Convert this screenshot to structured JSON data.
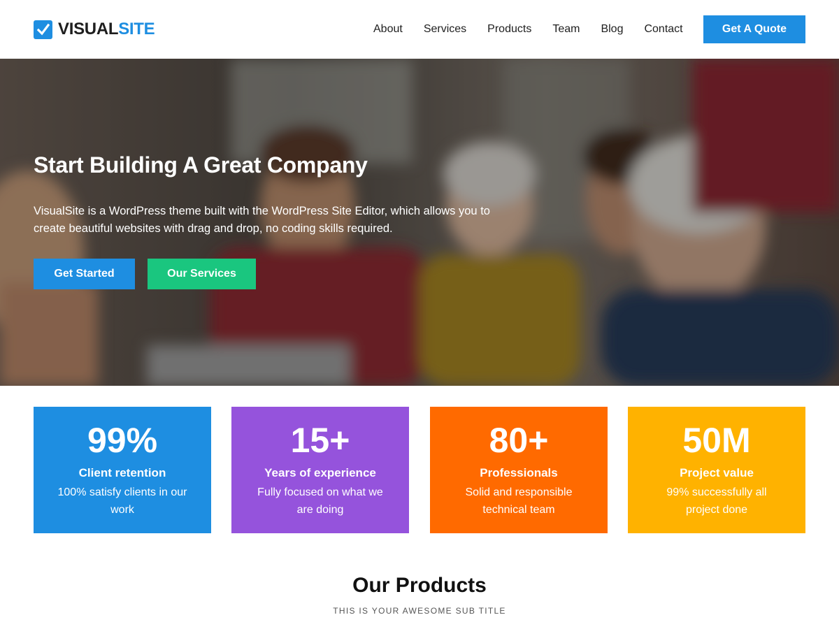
{
  "header": {
    "logo": {
      "part1": "VISUAL",
      "part2": "SITE"
    },
    "nav": [
      "About",
      "Services",
      "Products",
      "Team",
      "Blog",
      "Contact"
    ],
    "cta_label": "Get A Quote"
  },
  "hero": {
    "title": "Start Building A Great Company",
    "text": "VisualSite is a WordPress theme built with the WordPress Site Editor, which allows you to create beautiful websites with drag and drop, no coding skills required.",
    "primary_button": "Get Started",
    "secondary_button": "Our Services"
  },
  "stats": [
    {
      "value": "99%",
      "title": "Client retention",
      "desc": "100% satisfy clients in our work",
      "color": "#1e8ee1"
    },
    {
      "value": "15+",
      "title": "Years of experience",
      "desc": "Fully focused on what we are doing",
      "color": "#9553dc"
    },
    {
      "value": "80+",
      "title": "Professionals",
      "desc": "Solid and responsible technical team",
      "color": "#ff6a00"
    },
    {
      "value": "50M",
      "title": "Project value",
      "desc": "99% successfully all project done",
      "color": "#ffb200"
    }
  ],
  "products": {
    "title": "Our Products",
    "subtitle": "THIS IS YOUR AWESOME SUB TITLE"
  },
  "colors": {
    "accent": "#1e8ee1",
    "green": "#1ac67f"
  }
}
